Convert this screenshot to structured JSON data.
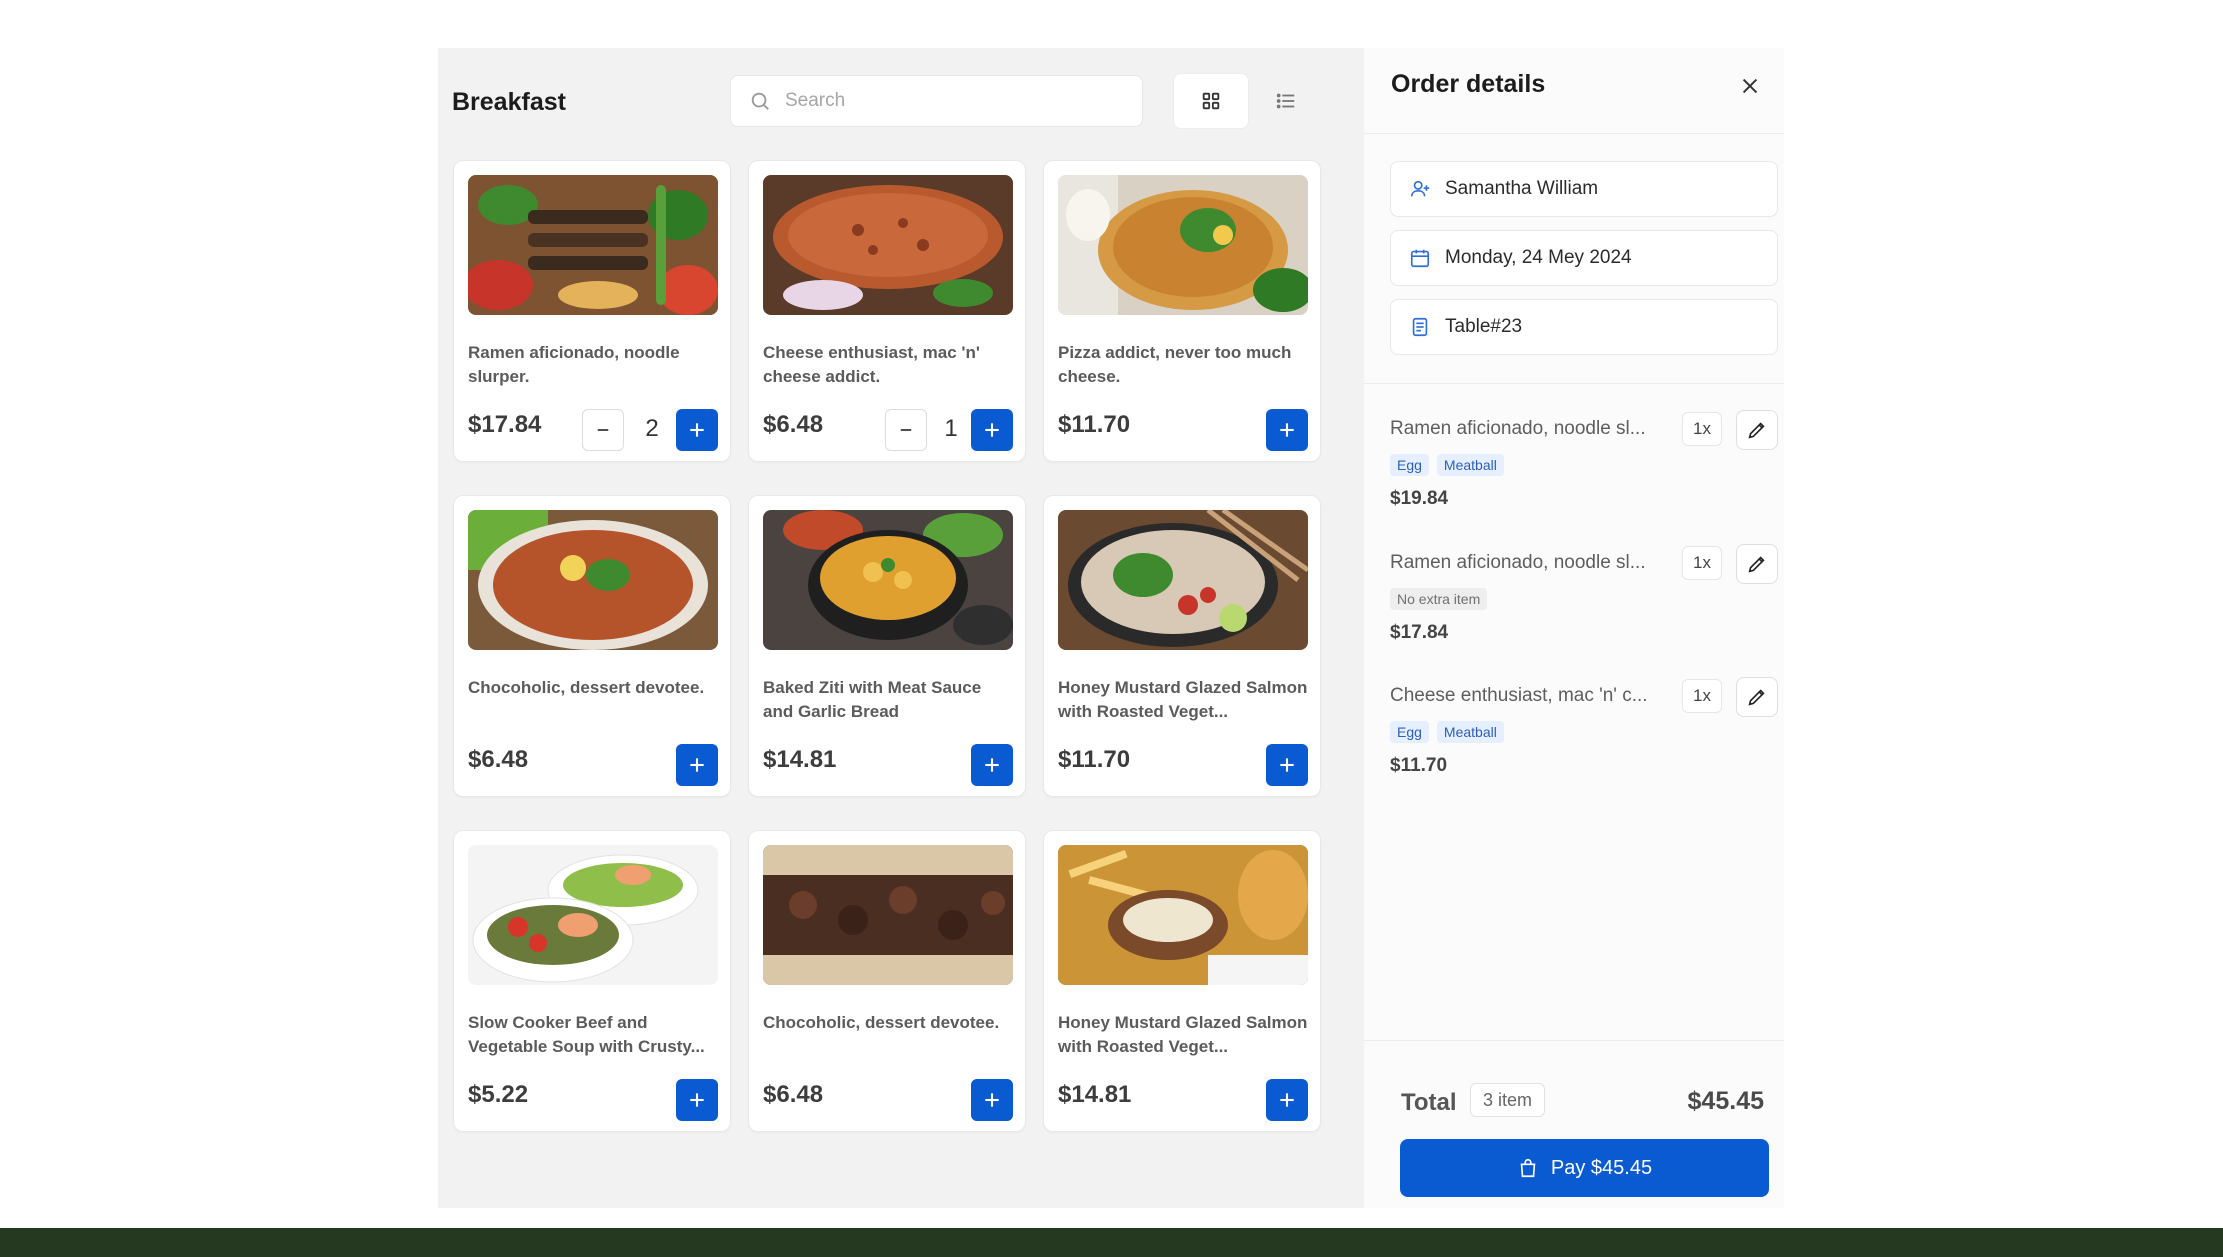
{
  "menu": {
    "title": "Breakfast",
    "search_placeholder": "Search",
    "grid_view_icon": "grid-icon",
    "list_view_icon": "list-icon"
  },
  "products": [
    {
      "name": "Ramen aficionado, noodle slurper.",
      "price": "$17.84",
      "qty": "2",
      "image": "skewers"
    },
    {
      "name": "Cheese enthusiast, mac 'n' cheese addict.",
      "price": "$6.48",
      "qty": "1",
      "image": "flatbread"
    },
    {
      "name": "Pizza addict, never too much cheese.",
      "price": "$11.70",
      "qty": "",
      "image": "pizza"
    },
    {
      "name": "Chocoholic, dessert devotee.",
      "price": "$6.48",
      "qty": "",
      "image": "lahmacun"
    },
    {
      "name": "Baked Ziti with Meat Sauce and Garlic Bread",
      "price": "$14.81",
      "qty": "",
      "image": "curry"
    },
    {
      "name": "Honey Mustard Glazed Salmon with Roasted Veget...",
      "price": "$11.70",
      "qty": "",
      "image": "noodle-salad"
    },
    {
      "name": "Slow Cooker Beef and Vegetable Soup with Crusty...",
      "price": "$5.22",
      "qty": "",
      "image": "salad-bowl"
    },
    {
      "name": "Chocoholic, dessert devotee.",
      "price": "$6.48",
      "qty": "",
      "image": "doner-wrap"
    },
    {
      "name": "Honey Mustard Glazed Salmon with Roasted Veget...",
      "price": "$14.81",
      "qty": "",
      "image": "fries-kebab"
    }
  ],
  "order": {
    "title": "Order details",
    "customer": "Samantha William",
    "date": "Monday, 24 Mey 2024",
    "table": "Table#23",
    "items": [
      {
        "name": "Ramen aficionado, noodle sl...",
        "qty": "1x",
        "tags": [
          "Egg",
          "Meatball"
        ],
        "tag_style": "blue",
        "price": "$19.84"
      },
      {
        "name": "Ramen aficionado, noodle sl...",
        "qty": "1x",
        "tags": [
          "No extra item"
        ],
        "tag_style": "grey",
        "price": "$17.84"
      },
      {
        "name": "Cheese enthusiast, mac 'n' c...",
        "qty": "1x",
        "tags": [
          "Egg",
          "Meatball"
        ],
        "tag_style": "blue",
        "price": "$11.70"
      }
    ],
    "total_label": "Total",
    "total_count": "3 item",
    "total_amount": "$45.45",
    "pay_label": "Pay $45.45"
  },
  "colors": {
    "accent": "#0a5bd1",
    "panel_bg": "#f2f2f2",
    "footer_band": "#24391f"
  }
}
